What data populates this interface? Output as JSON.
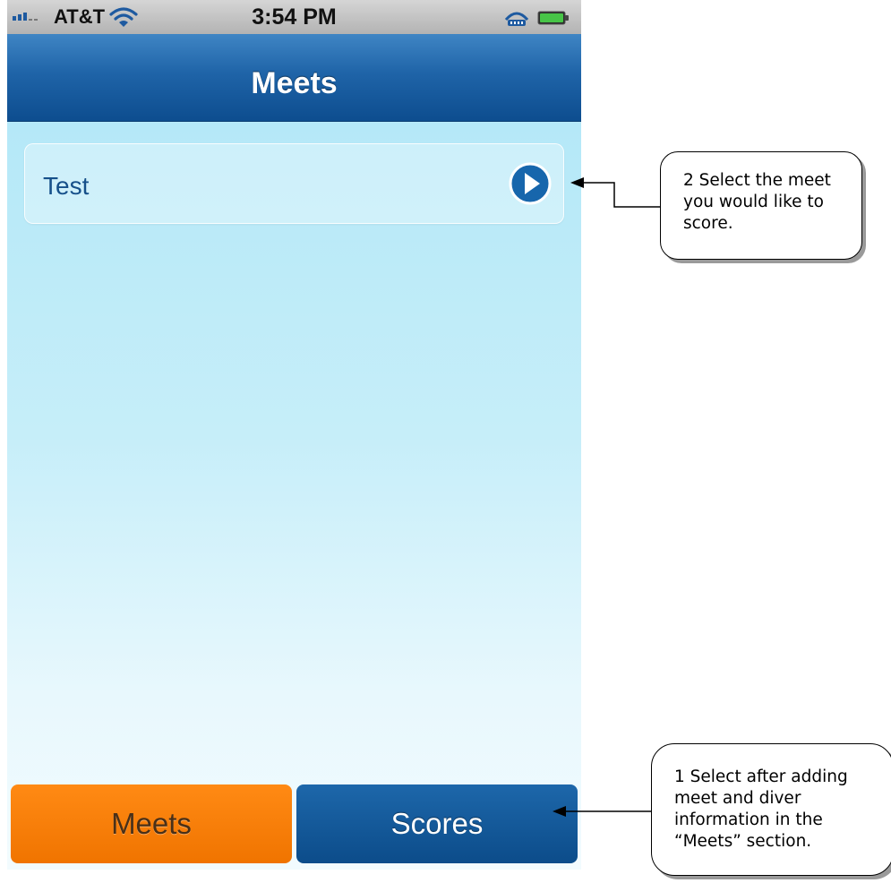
{
  "status_bar": {
    "carrier": "AT&T",
    "time": "3:54 PM"
  },
  "nav_bar": {
    "title": "Meets"
  },
  "meets_list": [
    {
      "label": "Test"
    }
  ],
  "tab_bar": {
    "meets_label": "Meets",
    "scores_label": "Scores"
  },
  "callouts": {
    "select_meet": "2  Select the meet you would like to score.",
    "select_scores": "1  Select after adding meet and diver information in the “Meets” section."
  },
  "colors": {
    "nav_bar": "#1f64a8",
    "meets_tab": "#f07400",
    "scores_tab": "#0c4c8a",
    "list_background": "#bfeaf8",
    "disclosure_button": "#1766ac"
  },
  "icons": [
    "signal-icon",
    "wifi-icon",
    "sync-icon",
    "battery-icon",
    "disclosure-arrow-icon"
  ]
}
